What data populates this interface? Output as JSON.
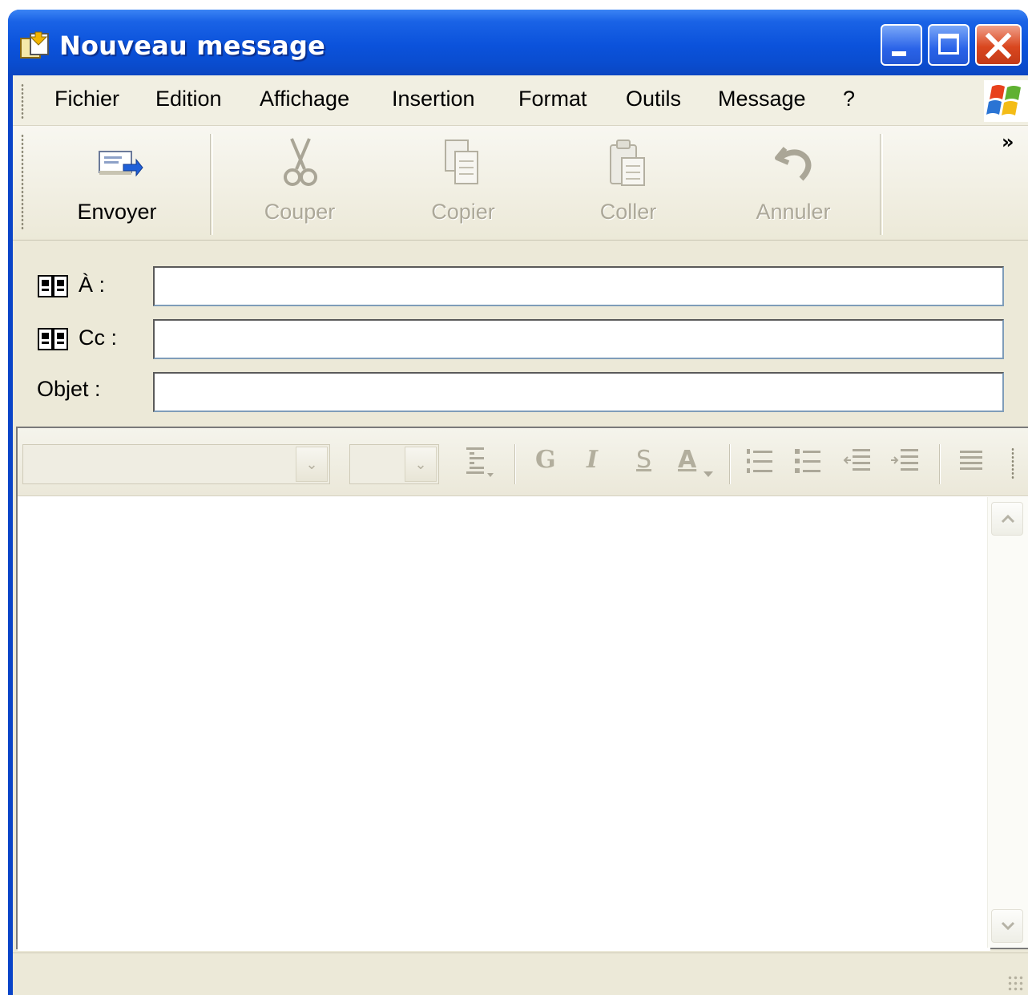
{
  "window": {
    "title": "Nouveau message",
    "title_bar_color": "#0a4dd0"
  },
  "menu": {
    "items": [
      "Fichier",
      "Edition",
      "Affichage",
      "Insertion",
      "Format",
      "Outils",
      "Message",
      "?"
    ]
  },
  "toolbar": {
    "send_label": "Envoyer",
    "cut_label": "Couper",
    "copy_label": "Copier",
    "paste_label": "Coller",
    "undo_label": "Annuler",
    "overflow_label": "»"
  },
  "header": {
    "to_label": "À :",
    "cc_label": "Cc :",
    "subject_label": "Objet :",
    "to_value": "",
    "cc_value": "",
    "subject_value": ""
  },
  "format_bar": {
    "font_value": "",
    "size_value": "",
    "bold_glyph": "G",
    "italic_glyph": "I",
    "underline_glyph": "S",
    "color_glyph": "A"
  },
  "body": {
    "text": ""
  },
  "icons": {
    "title": "new-message-icon",
    "send": "send-envelope-icon",
    "cut": "scissors-icon",
    "copy": "copy-icon",
    "paste": "clipboard-icon",
    "undo": "undo-icon",
    "address_book": "address-book-icon",
    "windows_logo": "windows-logo-icon"
  }
}
